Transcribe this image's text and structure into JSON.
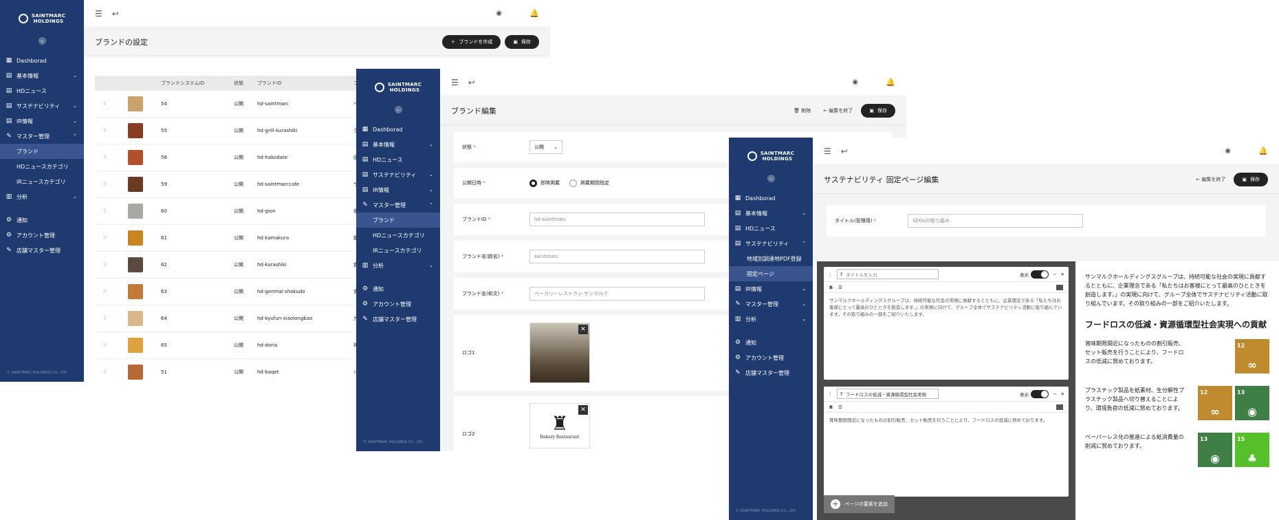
{
  "brand": {
    "line1": "SAINTMARC",
    "line2": "HOLDINGS"
  },
  "copyright": "© SAINTMARC HOLDINGS CO., LTD.",
  "nav": {
    "dashboard": "Dashborad",
    "basic": "基本情報",
    "hd_news": "HDニュース",
    "sustainability": "サステナビリティ",
    "ir": "IR情報",
    "master": "マスター管理",
    "brand": "ブランド",
    "hd_cat": "HDニュースカテゴリ",
    "ir_cat": "IRニュースカテゴリ",
    "analytics": "分析",
    "notify": "通知",
    "account": "アカウント管理",
    "store_master": "店舗マスター管理",
    "local_pdf": "地域別調達地PDF登録",
    "fixed_page": "固定ページ"
  },
  "w1": {
    "title": "ブランドの設定",
    "create": "ブランドを作成",
    "save": "保存",
    "cols": [
      "ブランドシステムID",
      "状態",
      "ブランドID",
      "ブ"
    ],
    "rows": [
      {
        "id": "54",
        "st": "公開",
        "bid": "hd-saintmarc",
        "n": "ベ",
        "c": "#c9a36b"
      },
      {
        "id": "55",
        "st": "公開",
        "bid": "hd-grill-kurashiki",
        "n": "グ",
        "c": "#8a3b24"
      },
      {
        "id": "58",
        "st": "公開",
        "bid": "hd-hakodate",
        "n": "函",
        "c": "#b0502c"
      },
      {
        "id": "59",
        "st": "公開",
        "bid": "hd-saintmarccafe",
        "n": "サ",
        "c": "#6b3a22"
      },
      {
        "id": "60",
        "st": "公開",
        "bid": "hd-gion",
        "n": "祇",
        "c": "#a7a9a2"
      },
      {
        "id": "61",
        "st": "公開",
        "bid": "hd-kamakura",
        "n": "鎌",
        "c": "#c9851f"
      },
      {
        "id": "62",
        "st": "公開",
        "bid": "hd-kurashiki",
        "n": "倉",
        "c": "#5a4a40"
      },
      {
        "id": "63",
        "st": "公開",
        "bid": "hd-genmai-shokudo",
        "n": "玄",
        "c": "#c27a3a"
      },
      {
        "id": "64",
        "st": "公開",
        "bid": "hd-kyufun-xiaolongbao",
        "n": "九",
        "c": "#d8b88a"
      },
      {
        "id": "65",
        "st": "公開",
        "bid": "hd-doria",
        "n": "神",
        "c": "#e0a23c"
      },
      {
        "id": "51",
        "st": "公開",
        "bid": "hd-baqet",
        "n": "バ",
        "c": "#b46a35"
      }
    ]
  },
  "w2": {
    "title": "ブランド編集",
    "delete": "削除",
    "end": "編集を終了",
    "save": "保存",
    "status_label": "状態",
    "status_val": "公開",
    "date_label": "公開日時",
    "r1": "即時掲載",
    "r2": "掲載期間指定",
    "brandid_label": "ブランドID",
    "brandid_val": "hd-saintmarc",
    "name_en_label": "ブランド名(欧名)",
    "name_en_val": "saintmarc",
    "name_ja_label": "ブランド名(和文)",
    "name_ja_ph": "ベーカリーレストラン サンマルク",
    "logo1": "ロゴ1",
    "logo2": "ロゴ2",
    "logo2_text": "Bakery Restaurant"
  },
  "w3": {
    "title": "サステナビリティ 固定ページ編集",
    "end": "編集を終了",
    "save": "保存",
    "title_label": "タイトル(管理用)",
    "title_val": "SDGsの取り組み",
    "c1_ph": "タイトルを入力",
    "show": "表示",
    "c1_text": "サンマルクホールディングスグループは、持続可能な社会の実現に貢献するとともに、企業理念である「私たちはお客様にとって最高のひとときを創造します。」の実現に向けて、グループ全体でサステナビリティ活動に取り組んでいます。その取り組みの一部をご紹介いたします。",
    "c2_title": "フードロスの低減・資源循環型社会実現",
    "c2_text": "賞味期限間近になったものの割引販売、セット販売を行うことにより、フードロスの低減に努めております。",
    "add": "ページの要素を追加",
    "pv_intro": "サンマルクホールディングスグループは、持続可能な社会の実現に貢献するとともに、企業理念である「私たちはお客様にとって最高のひとときを創造します。」の実現に向けて、グループ全体でサステナビリティ活動に取り組んでいます。その取り組みの一部をご紹介いたします。",
    "pv_h2": "フードロスの低減・資源循環型社会実現への貢献",
    "pv_p1": "賞味期限間近になったものの割引販売、セット販売を行うことにより、フードロスの低減に努めております。",
    "pv_p2": "プラスチック製品を紙素材、生分解性プラスチック製品へ切り替えることにより、環境負荷の低減に努めております。",
    "pv_p3": "ペーパーレス化の推進による紙消費量の削減に努めております。",
    "sdg12": "12",
    "sdg13": "13",
    "sdg15": "15"
  }
}
